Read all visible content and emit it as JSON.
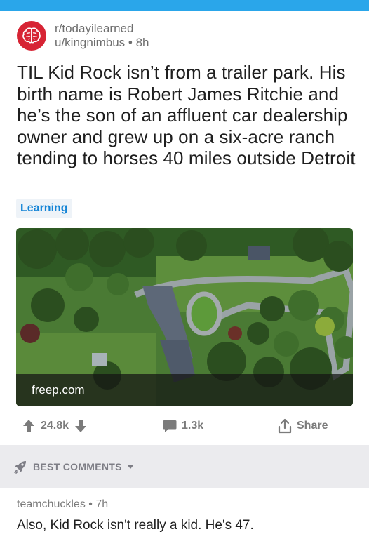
{
  "post": {
    "subreddit": "r/todayilearned",
    "user": "u/kingnimbus",
    "age": "8h",
    "title": "TIL Kid Rock isn’t from a trailer park. His birth name is Robert James Ritchie and he’s the son of an affluent car dealership owner and grew up on a six-acre ranch tending to horses 40 miles outside Detroit",
    "flair": "Learning",
    "link_domain": "freep.com",
    "score": "24.8k",
    "comments": "1.3k",
    "share_label": "Share"
  },
  "comments_header": {
    "sort_label": "BEST COMMENTS"
  },
  "comments": [
    {
      "author": "teamchuckles",
      "age": "7h",
      "body": "Also, Kid Rock isn't really a kid. He's 47."
    }
  ],
  "colors": {
    "topbar": "#2aa6ea",
    "subreddit_icon": "#d72434",
    "flair_text": "#1484d6",
    "flair_bg": "#eef3f8",
    "band": "#ebebee"
  },
  "icons": {
    "subreddit": "brain-icon",
    "upvote": "up-arrow-icon",
    "downvote": "down-arrow-icon",
    "comments": "speech-bubble-icon",
    "share": "share-icon",
    "sort": "rocket-icon",
    "sort_caret": "caret-down-icon"
  }
}
